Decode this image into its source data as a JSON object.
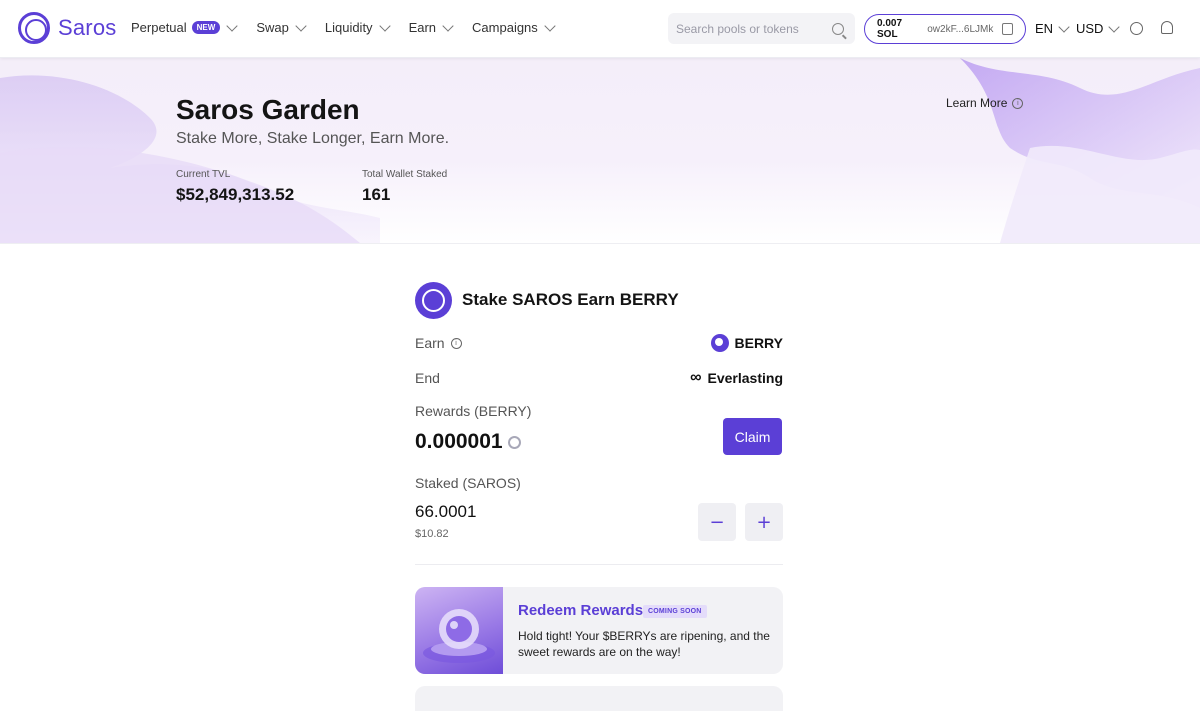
{
  "nav": {
    "brand": "Saros",
    "menu": [
      {
        "label": "Perpetual",
        "badge": "NEW"
      },
      {
        "label": "Swap"
      },
      {
        "label": "Liquidity"
      },
      {
        "label": "Earn"
      },
      {
        "label": "Campaigns"
      }
    ],
    "search_placeholder": "Search pools or tokens",
    "wallet": {
      "balance": "0.007 SOL",
      "address": "ow2kF...6LJMk"
    },
    "language": "EN",
    "currency": "USD",
    "accent": "#5b3fd6"
  },
  "hero": {
    "title": "Saros Garden",
    "subtitle": "Stake More, Stake Longer, Earn More.",
    "learn_more": "Learn More",
    "stats": [
      {
        "label": "Current TVL",
        "value": "$52,849,313.52"
      },
      {
        "label": "Total Wallet Staked",
        "value": "161"
      }
    ]
  },
  "card": {
    "title": "Stake SAROS Earn BERRY",
    "earn_label": "Earn",
    "earn_token": "BERRY",
    "end_label": "End",
    "end_symbol": "∞",
    "end_value": "Everlasting",
    "rewards_label": "Rewards (BERRY)",
    "rewards_value": "0.000001",
    "claim_label": "Claim",
    "staked_label": "Staked (SAROS)",
    "staked_value": "66.0001",
    "staked_usd": "$10.82",
    "minus_label": "−",
    "plus_label": "+"
  },
  "redeem": {
    "title": "Redeem Rewards",
    "badge": "COMING SOON",
    "description": "Hold tight! Your $BERRYs are ripening, and the sweet rewards are on the way!"
  }
}
